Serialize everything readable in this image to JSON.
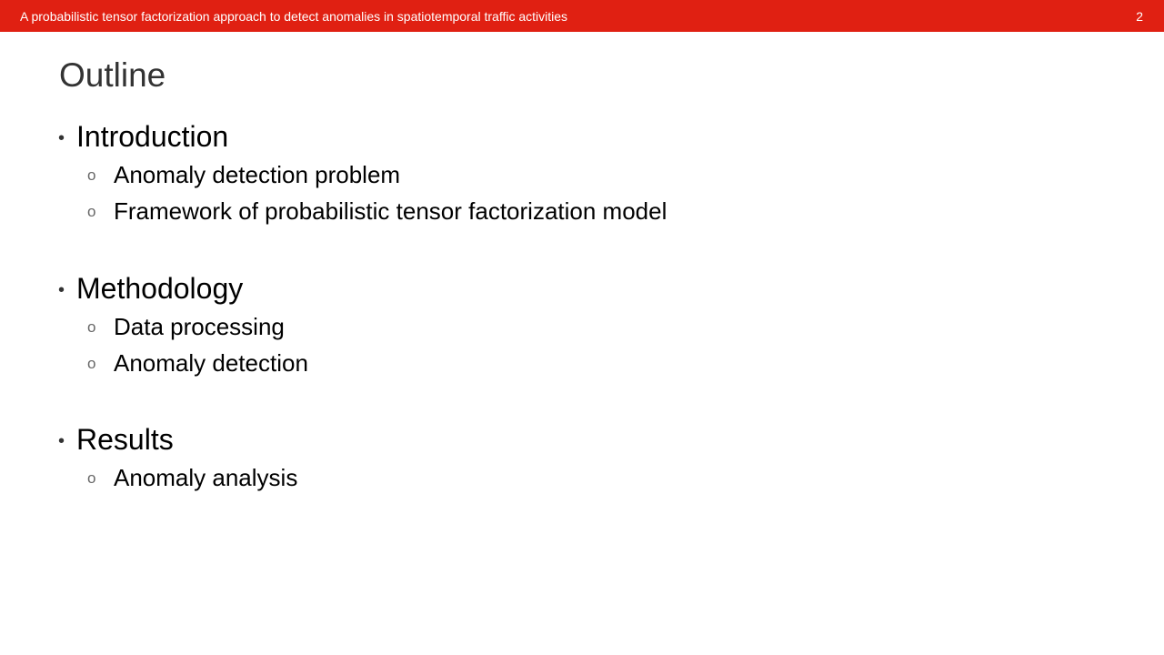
{
  "header": {
    "title": "A probabilistic tensor factorization approach to detect anomalies in spatiotemporal traffic activities",
    "page_number": "2"
  },
  "slide": {
    "title": "Outline"
  },
  "outline": {
    "main_bullet": "•",
    "sub_bullet": "o",
    "sections": [
      {
        "label": "Introduction",
        "items": [
          "Anomaly detection problem",
          "Framework of probabilistic tensor factorization model"
        ]
      },
      {
        "label": "Methodology",
        "items": [
          "Data processing",
          "Anomaly detection"
        ]
      },
      {
        "label": "Results",
        "items": [
          "Anomaly analysis"
        ]
      }
    ]
  },
  "colors": {
    "header_bar": "#e02012",
    "title_text": "#333333",
    "body_text": "#000000"
  }
}
